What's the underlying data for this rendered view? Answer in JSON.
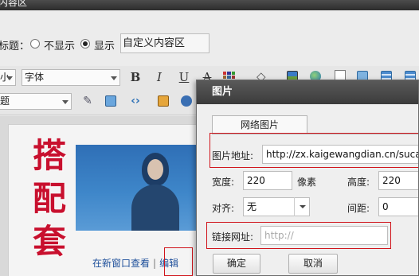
{
  "window": {
    "title_fragment": "内容区"
  },
  "title_option": {
    "label": "标题：",
    "options": [
      {
        "label": "不显示",
        "selected": false
      },
      {
        "label": "显示",
        "selected": true
      }
    ],
    "value": "自定义内容区"
  },
  "toolbar": {
    "size_select": "小",
    "font_select": "字体",
    "format_select": "题",
    "buttons": [
      {
        "icon": "bold-icon",
        "glyph": "B"
      },
      {
        "icon": "italic-icon",
        "glyph": "I"
      },
      {
        "icon": "underline-icon",
        "glyph": "U"
      },
      {
        "icon": "strikethrough-icon",
        "glyph": "A"
      }
    ]
  },
  "content": {
    "vertical_text": "搭配套",
    "link_new_window": "在新窗口查看",
    "link_separator": "|",
    "link_edit": "编辑"
  },
  "dialog": {
    "title": "图片",
    "tab_label": "网络图片",
    "url_label": "图片地址:",
    "url_value": "http://zx.kaigewangdian.cn/sucaimo",
    "width_label": "宽度:",
    "width_value": "220",
    "width_unit": "像素",
    "height_label": "高度:",
    "height_value": "220",
    "align_label": "对齐:",
    "align_value": "无",
    "spacing_label": "间距:",
    "spacing_value": "0",
    "link_label": "链接网址:",
    "link_placeholder": "http://",
    "ok_label": "确定",
    "cancel_label": "取消"
  },
  "colors": {
    "highlight_box": "#d0141b",
    "vertical_text": "#c8102e",
    "link": "#1e4f9a"
  }
}
